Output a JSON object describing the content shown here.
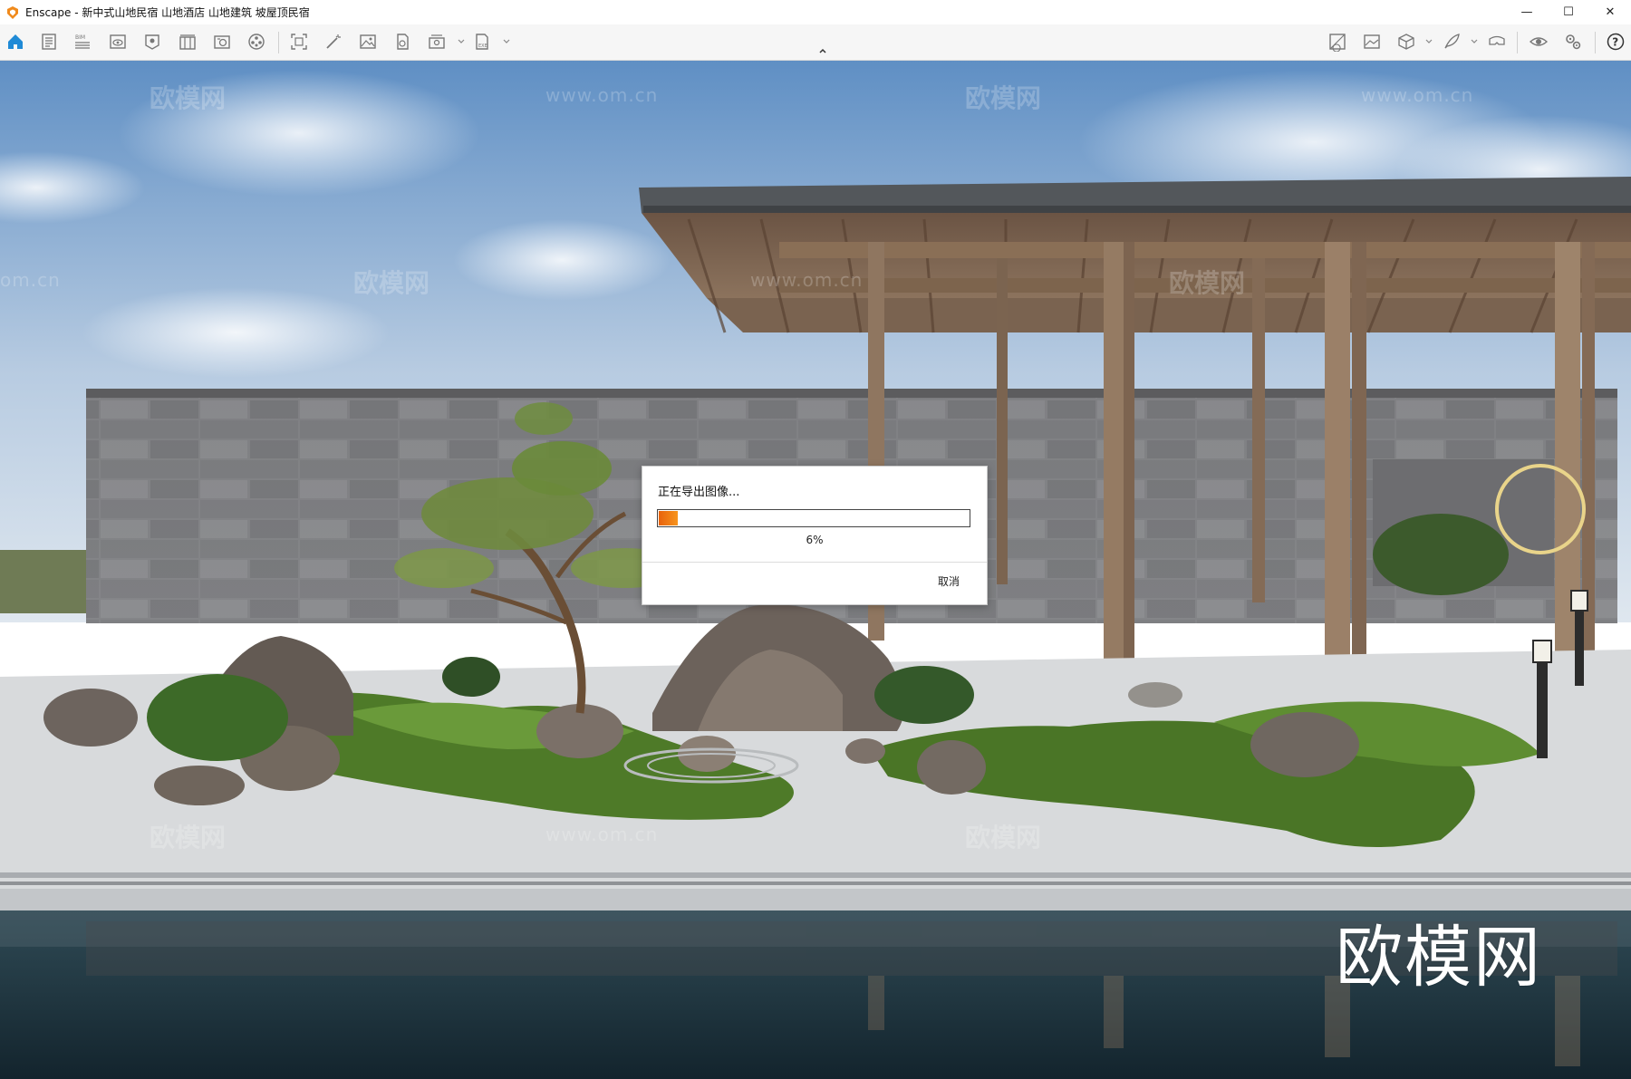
{
  "window": {
    "title": "Enscape - 新中式山地民宿 山地酒店 山地建筑 坡屋顶民宿",
    "controls": {
      "minimize": "—",
      "maximize": "☐",
      "close": "✕"
    }
  },
  "toolbar": {
    "left_tools": [
      "home-icon",
      "document-icon",
      "bim-icon",
      "visibility-icon",
      "pin-icon",
      "library-icon",
      "asset-editor-icon",
      "material-icon",
      "screenshot-icon",
      "magic-wand-icon",
      "image-icon",
      "panorama-icon",
      "batch-render-icon",
      "export-icon"
    ],
    "right_tools": [
      "capture-view-icon",
      "gallery-icon",
      "cube-icon",
      "feather-icon",
      "vr-headset-icon",
      "eye-icon",
      "settings-icon",
      "help-icon"
    ],
    "collapse_toggle": "chevron-up-icon",
    "accent_color": "#1f8ad6"
  },
  "watermarks": {
    "brand": "欧模网",
    "url": "www.om.cn",
    "url_partial": "om.cn",
    "big": "欧模网"
  },
  "dialog": {
    "title": "正在导出图像...",
    "progress_value": 0.06,
    "progress_label": "6%",
    "cancel_label": "取消",
    "progress_color": "#f07a14"
  }
}
